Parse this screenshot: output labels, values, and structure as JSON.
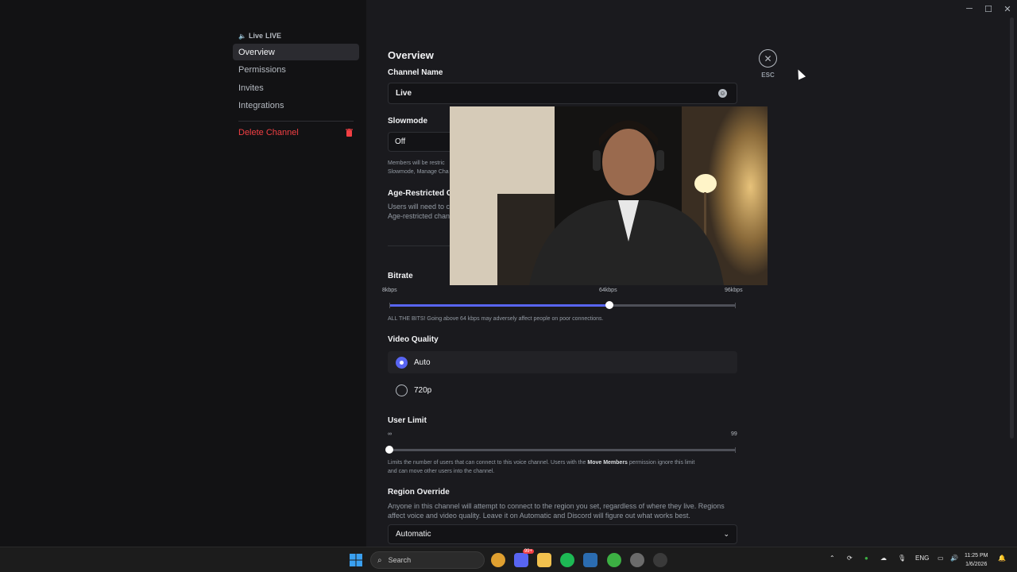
{
  "window": {
    "controls": [
      "─",
      "☐",
      "✕"
    ]
  },
  "sidebar": {
    "header_prefix": "Live",
    "header_suffix": "LIVE",
    "items": [
      {
        "label": "Overview"
      },
      {
        "label": "Permissions"
      },
      {
        "label": "Invites"
      },
      {
        "label": "Integrations"
      }
    ],
    "delete_label": "Delete Channel"
  },
  "main": {
    "title": "Overview",
    "close_label": "ESC",
    "channel_name": {
      "label": "Channel Name",
      "value": "Live"
    },
    "slowmode": {
      "label": "Slowmode",
      "value": "Off",
      "help_line1": "Members will be restric",
      "help_line2": "Slowmode, Manage Cha"
    },
    "age_restricted": {
      "label": "Age-Restricted C",
      "line1": "Users will need to c",
      "line2": "Age-restricted chan"
    },
    "bitrate": {
      "label": "Bitrate",
      "ticks": [
        "8kbps",
        "64kbps",
        "96kbps"
      ],
      "value_kbps": 64,
      "min_kbps": 8,
      "max_kbps": 96,
      "help": "ALL THE BITS! Going above 64 kbps may adversely affect people on poor connections."
    },
    "video_quality": {
      "label": "Video Quality",
      "options": [
        "Auto",
        "720p"
      ],
      "selected": "Auto"
    },
    "user_limit": {
      "label": "User Limit",
      "min_label": "∞",
      "max_label": "99",
      "value": 0,
      "help_pre": "Limits the number of users that can connect to this voice channel. Users with the ",
      "help_bold": "Move Members",
      "help_post": " permission ignore this limit",
      "help_line2": "and can move other users into the channel."
    },
    "region_override": {
      "label": "Region Override",
      "line1": "Anyone in this channel will attempt to connect to the region you set, regardless of where they live. Regions",
      "line2": "affect voice and video quality. Leave it on Automatic and Discord will figure out what works best.",
      "value": "Automatic"
    }
  },
  "taskbar": {
    "search_placeholder": "Search",
    "discord_badge": "99+",
    "tray_language": "ENG",
    "time": "11:25 PM",
    "date": "1/6/2026"
  },
  "colors": {
    "accent": "#5865f2",
    "danger": "#f23f43",
    "sidebar_bg": "#121214",
    "main_bg": "#1a1a1e"
  }
}
